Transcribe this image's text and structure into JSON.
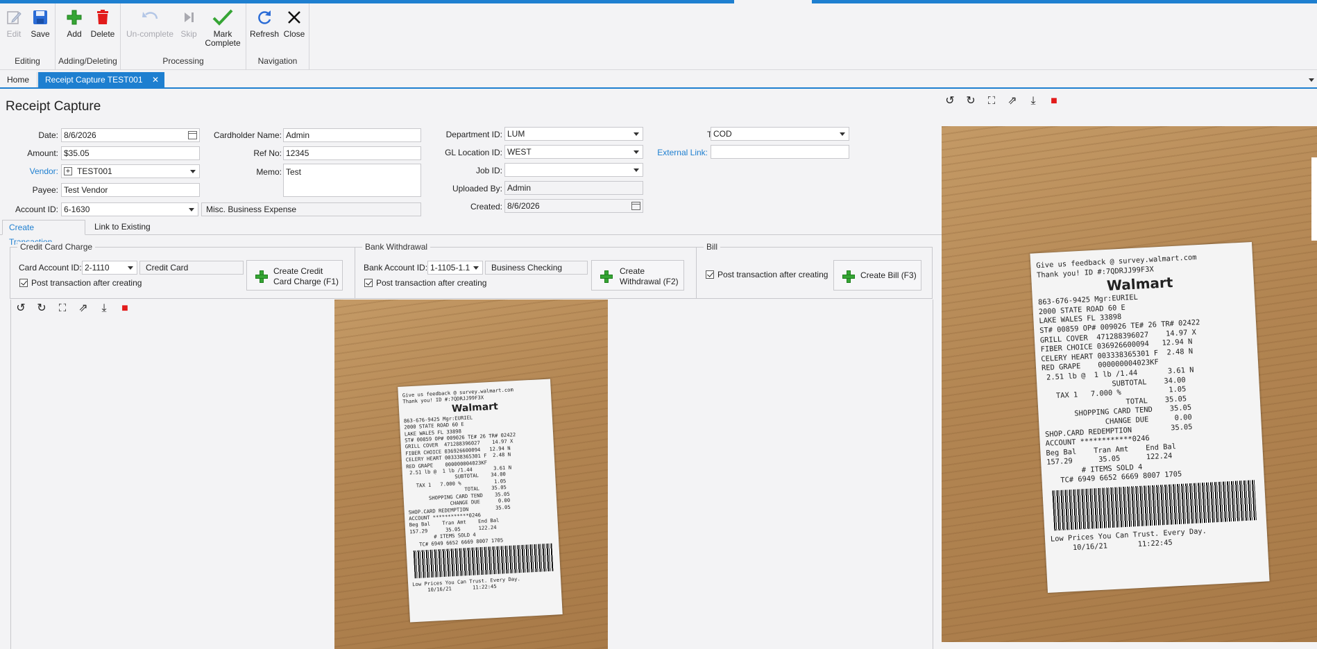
{
  "ribbon": {
    "groups": [
      {
        "label": "Editing",
        "buttons": [
          {
            "label": "Edit"
          },
          {
            "label": "Save"
          }
        ]
      },
      {
        "label": "Adding/Deleting",
        "buttons": [
          {
            "label": "Add"
          },
          {
            "label": "Delete"
          }
        ]
      },
      {
        "label": "Processing",
        "buttons": [
          {
            "label": "Un-complete"
          },
          {
            "label": "Skip"
          },
          {
            "label": "Mark"
          },
          {
            "label": "Complete"
          }
        ]
      },
      {
        "label": "Navigation",
        "buttons": [
          {
            "label": "Refresh"
          },
          {
            "label": "Close"
          }
        ]
      }
    ]
  },
  "tabs": {
    "home": "Home",
    "active": "Receipt Capture TEST001",
    "close_glyph": "✕"
  },
  "page": {
    "title": "Receipt Capture"
  },
  "form": {
    "date": {
      "label": "Date:",
      "value": "8/6/2026"
    },
    "amount": {
      "label": "Amount:",
      "value": "$35.05"
    },
    "vendor": {
      "label": "Vendor:",
      "value": "TEST001"
    },
    "payee": {
      "label": "Payee:",
      "value": "Test Vendor"
    },
    "account": {
      "label": "Account ID:",
      "value": "6-1630",
      "description": "Misc. Business Expense"
    },
    "cardholder": {
      "label": "Cardholder Name:",
      "value": "Admin"
    },
    "ref_no": {
      "label": "Ref No:",
      "value": "12345"
    },
    "memo": {
      "label": "Memo:",
      "value": "Test"
    },
    "department": {
      "label": "Department ID:",
      "value": "LUM"
    },
    "gl_location": {
      "label": "GL Location ID:",
      "value": "WEST"
    },
    "job": {
      "label": "Job ID:",
      "value": ""
    },
    "uploaded_by": {
      "label": "Uploaded By:",
      "value": "Admin"
    },
    "created": {
      "label": "Created:",
      "value": "8/6/2026"
    },
    "terms": {
      "label": "Terms:",
      "value": "COD"
    },
    "external_link": {
      "label": "External Link:",
      "value": ""
    }
  },
  "subtabs": [
    "Create Transaction",
    "Link to Existing"
  ],
  "credit_card": {
    "title": "Credit Card Charge",
    "account_label": "Card Account ID:",
    "account_value": "2-1110",
    "account_desc": "Credit Card",
    "post_label": "Post transaction after creating",
    "button_line1": "Create Credit",
    "button_line2": "Card Charge (F1)"
  },
  "bank": {
    "title": "Bank Withdrawal",
    "account_label": "Bank Account ID:",
    "account_value": "1-1105-1.1",
    "account_desc": "Business Checking",
    "post_label": "Post transaction after creating",
    "button_line1": "Create",
    "button_line2": "Withdrawal (F2)"
  },
  "bill": {
    "title": "Bill",
    "post_label": "Post transaction after creating",
    "button": "Create Bill (F3)"
  },
  "image_tools": [
    "rotate-left",
    "rotate-right",
    "fit",
    "open-external",
    "download",
    "delete"
  ],
  "receipt": {
    "lines": [
      "Give us feedback @ survey.walmart.com",
      "Thank you! ID #:7QDRJJ99F3X",
      "Walmart",
      "863-676-9425 Mgr:EURIEL",
      "2000 STATE ROAD 60 E",
      "LAKE WALES FL 33898",
      "ST# 00859 OP# 009026 TE# 26 TR# 02422",
      "GRILL COVER  471288396027    14.97 X",
      "FIBER CHOICE 036926600094   12.94 N",
      "CELERY HEART 003338365301 F  2.48 N",
      "RED GRAPE    000000004023KF",
      " 2.51 lb @  1 lb /1.44       3.61 N",
      "                SUBTOTAL    34.00",
      "   TAX 1   7.000 %           1.05",
      "                   TOTAL    35.05",
      "       SHOPPING CARD TEND    35.05",
      "              CHANGE DUE      0.00",
      "SHOP.CARD REDEMPTION         35.05",
      "ACCOUNT ************0246",
      "Beg Bal    Tran Amt    End Bal",
      "157.29      35.05      122.24",
      "        # ITEMS SOLD 4",
      "   TC# 6949 6652 6669 8007 1705",
      "Low Prices You Can Trust. Every Day.",
      "     10/16/21       11:22:45"
    ]
  },
  "colors": {
    "accent": "#1e7fd0",
    "add": "#36a535",
    "delete": "#e21b1b",
    "save": "#2b6cd6"
  }
}
